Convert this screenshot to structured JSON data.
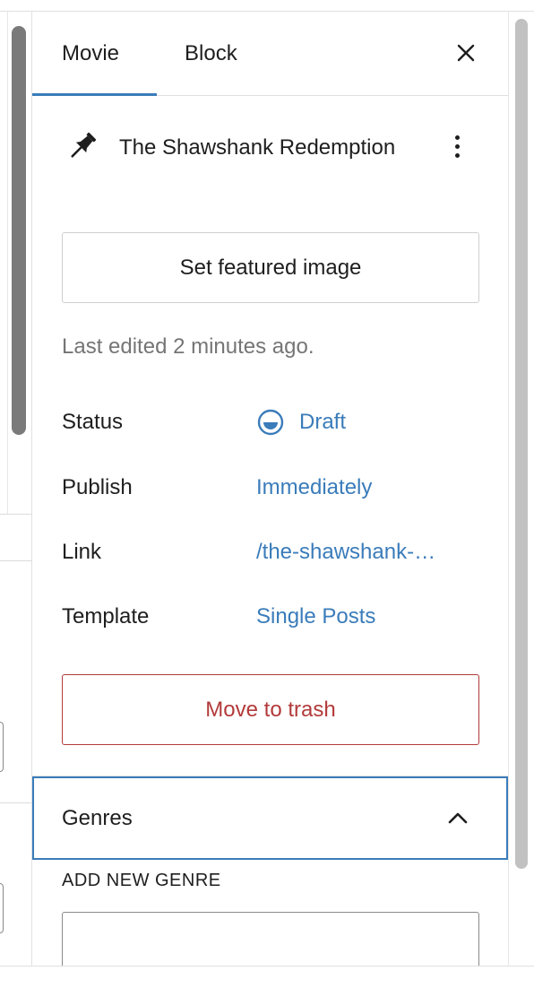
{
  "tabs": [
    {
      "label": "Movie",
      "active": true
    },
    {
      "label": "Block",
      "active": false
    }
  ],
  "close_icon": "close-icon",
  "post": {
    "title": "The Shawshank Redemption",
    "icon": "pin-icon",
    "options_icon": "more-vertical-icon"
  },
  "featured_image_button": "Set featured image",
  "last_edited": "Last edited 2 minutes ago.",
  "meta": {
    "status": {
      "label": "Status",
      "value": "Draft",
      "icon": "draft-status-icon"
    },
    "publish": {
      "label": "Publish",
      "value": "Immediately"
    },
    "link": {
      "label": "Link",
      "value": "/the-shawshank-…"
    },
    "template": {
      "label": "Template",
      "value": "Single Posts"
    }
  },
  "trash_button": "Move to trash",
  "genres_panel": {
    "title": "Genres",
    "icon": "chevron-up-icon",
    "expanded": true,
    "add_new_label": "ADD NEW GENRE",
    "input_value": ""
  },
  "colors": {
    "accent": "#3a7cba",
    "danger": "#b33a3a",
    "muted_text": "#757575",
    "text": "#1e1e1e"
  }
}
